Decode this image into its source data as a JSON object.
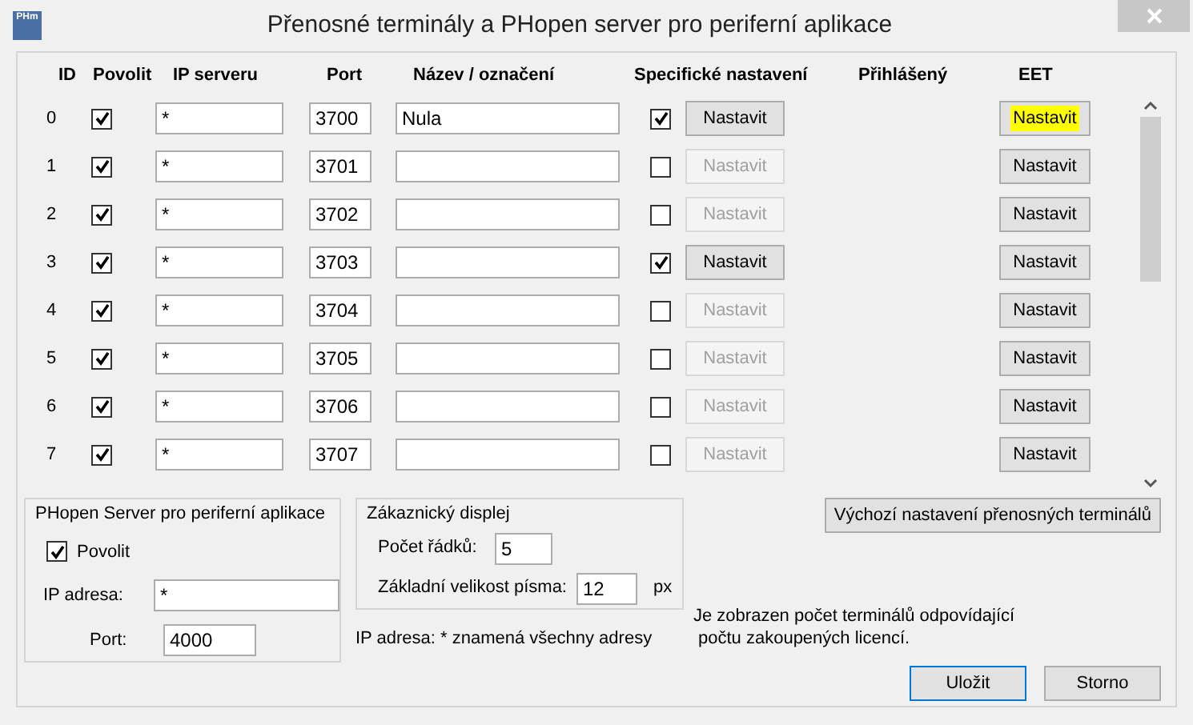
{
  "window": {
    "title": "Přenosné terminály a PHopen server pro periferní aplikace",
    "icon_text": "PHm"
  },
  "table": {
    "columns": [
      "ID",
      "Povolit",
      "IP serveru",
      "Port",
      "Název / označení",
      "Specifické nastavení",
      "Přihlášený",
      "EET"
    ],
    "rows": [
      {
        "id": "0",
        "enabled": true,
        "ip": "*",
        "port": "3700",
        "name": "Nula",
        "specific": true,
        "specific_button": "Nastavit",
        "eet_button": "Nastavit",
        "eet_highlighted": true
      },
      {
        "id": "1",
        "enabled": true,
        "ip": "*",
        "port": "3701",
        "name": "",
        "specific": false,
        "specific_button": "Nastavit",
        "eet_button": "Nastavit",
        "eet_highlighted": false
      },
      {
        "id": "2",
        "enabled": true,
        "ip": "*",
        "port": "3702",
        "name": "",
        "specific": false,
        "specific_button": "Nastavit",
        "eet_button": "Nastavit",
        "eet_highlighted": false
      },
      {
        "id": "3",
        "enabled": true,
        "ip": "*",
        "port": "3703",
        "name": "",
        "specific": true,
        "specific_button": "Nastavit",
        "eet_button": "Nastavit",
        "eet_highlighted": false
      },
      {
        "id": "4",
        "enabled": true,
        "ip": "*",
        "port": "3704",
        "name": "",
        "specific": false,
        "specific_button": "Nastavit",
        "eet_button": "Nastavit",
        "eet_highlighted": false
      },
      {
        "id": "5",
        "enabled": true,
        "ip": "*",
        "port": "3705",
        "name": "",
        "specific": false,
        "specific_button": "Nastavit",
        "eet_button": "Nastavit",
        "eet_highlighted": false
      },
      {
        "id": "6",
        "enabled": true,
        "ip": "*",
        "port": "3706",
        "name": "",
        "specific": false,
        "specific_button": "Nastavit",
        "eet_button": "Nastavit",
        "eet_highlighted": false
      },
      {
        "id": "7",
        "enabled": true,
        "ip": "*",
        "port": "3707",
        "name": "",
        "specific": false,
        "specific_button": "Nastavit",
        "eet_button": "Nastavit",
        "eet_highlighted": false
      }
    ]
  },
  "phopen": {
    "title": "PHopen Server pro periferní aplikace",
    "enable_label": "Povolit",
    "enabled": true,
    "ip_label": "IP adresa:",
    "ip": "*",
    "port_label": "Port:",
    "port": "4000"
  },
  "display": {
    "title": "Zákaznický displej",
    "rows_label": "Počet řádků:",
    "rows": "5",
    "font_label": "Základní velikost písma:",
    "font_size": "12",
    "unit": "px"
  },
  "ip_note": "IP adresa: * znamená všechny adresy",
  "default_button": "Výchozí nastavení přenosných terminálů",
  "license_note": [
    "Je zobrazen počet terminálů odpovídající",
    "počtu zakoupených licencí."
  ],
  "buttons": [
    "Uložit",
    "Storno"
  ]
}
